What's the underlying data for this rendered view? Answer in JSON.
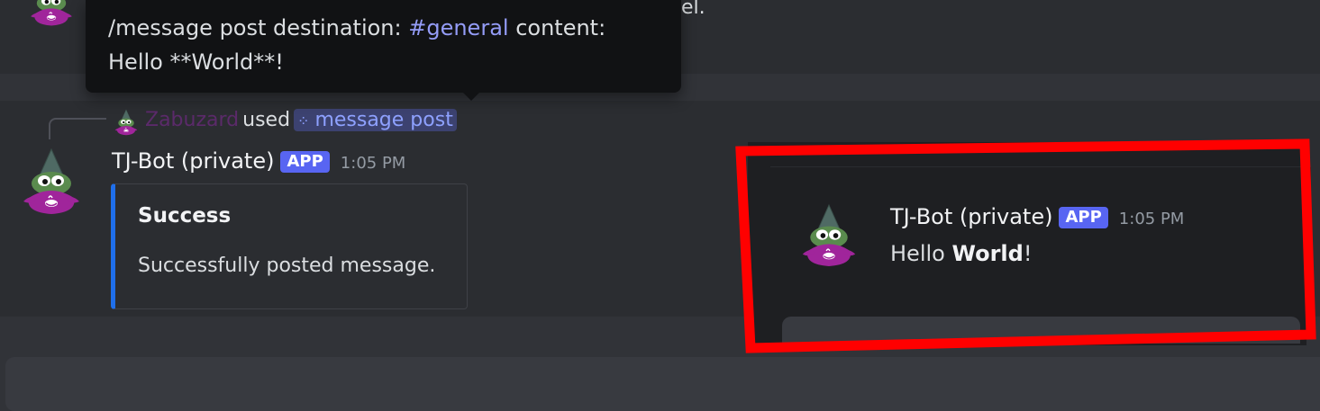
{
  "top": {
    "tail_text": "el."
  },
  "tooltip": {
    "line1_prefix": "/message post destination: ",
    "channel": "#general",
    "line1_suffix": " content:",
    "line2": "Hello **World**!"
  },
  "reply": {
    "user": "Zabuzard",
    "used": "used",
    "command_icon": "slash-command-icon",
    "command": "message post"
  },
  "message": {
    "author": "TJ-Bot (private)",
    "badge": "APP",
    "time": "1:05 PM",
    "embed": {
      "title": "Success",
      "description": "Successfully posted message.",
      "accent_color": "#1f6feb"
    }
  },
  "popout": {
    "author": "TJ-Bot (private)",
    "badge": "APP",
    "time": "1:05 PM",
    "text_prefix": "Hello ",
    "text_bold": "World",
    "text_suffix": "!",
    "highlight_color": "#ff0000"
  },
  "colors": {
    "background": "#313338",
    "message_bg": "#2b2d31",
    "tooltip_bg": "#111214",
    "badge": "#5865f2",
    "channel_link": "#949cf7"
  }
}
